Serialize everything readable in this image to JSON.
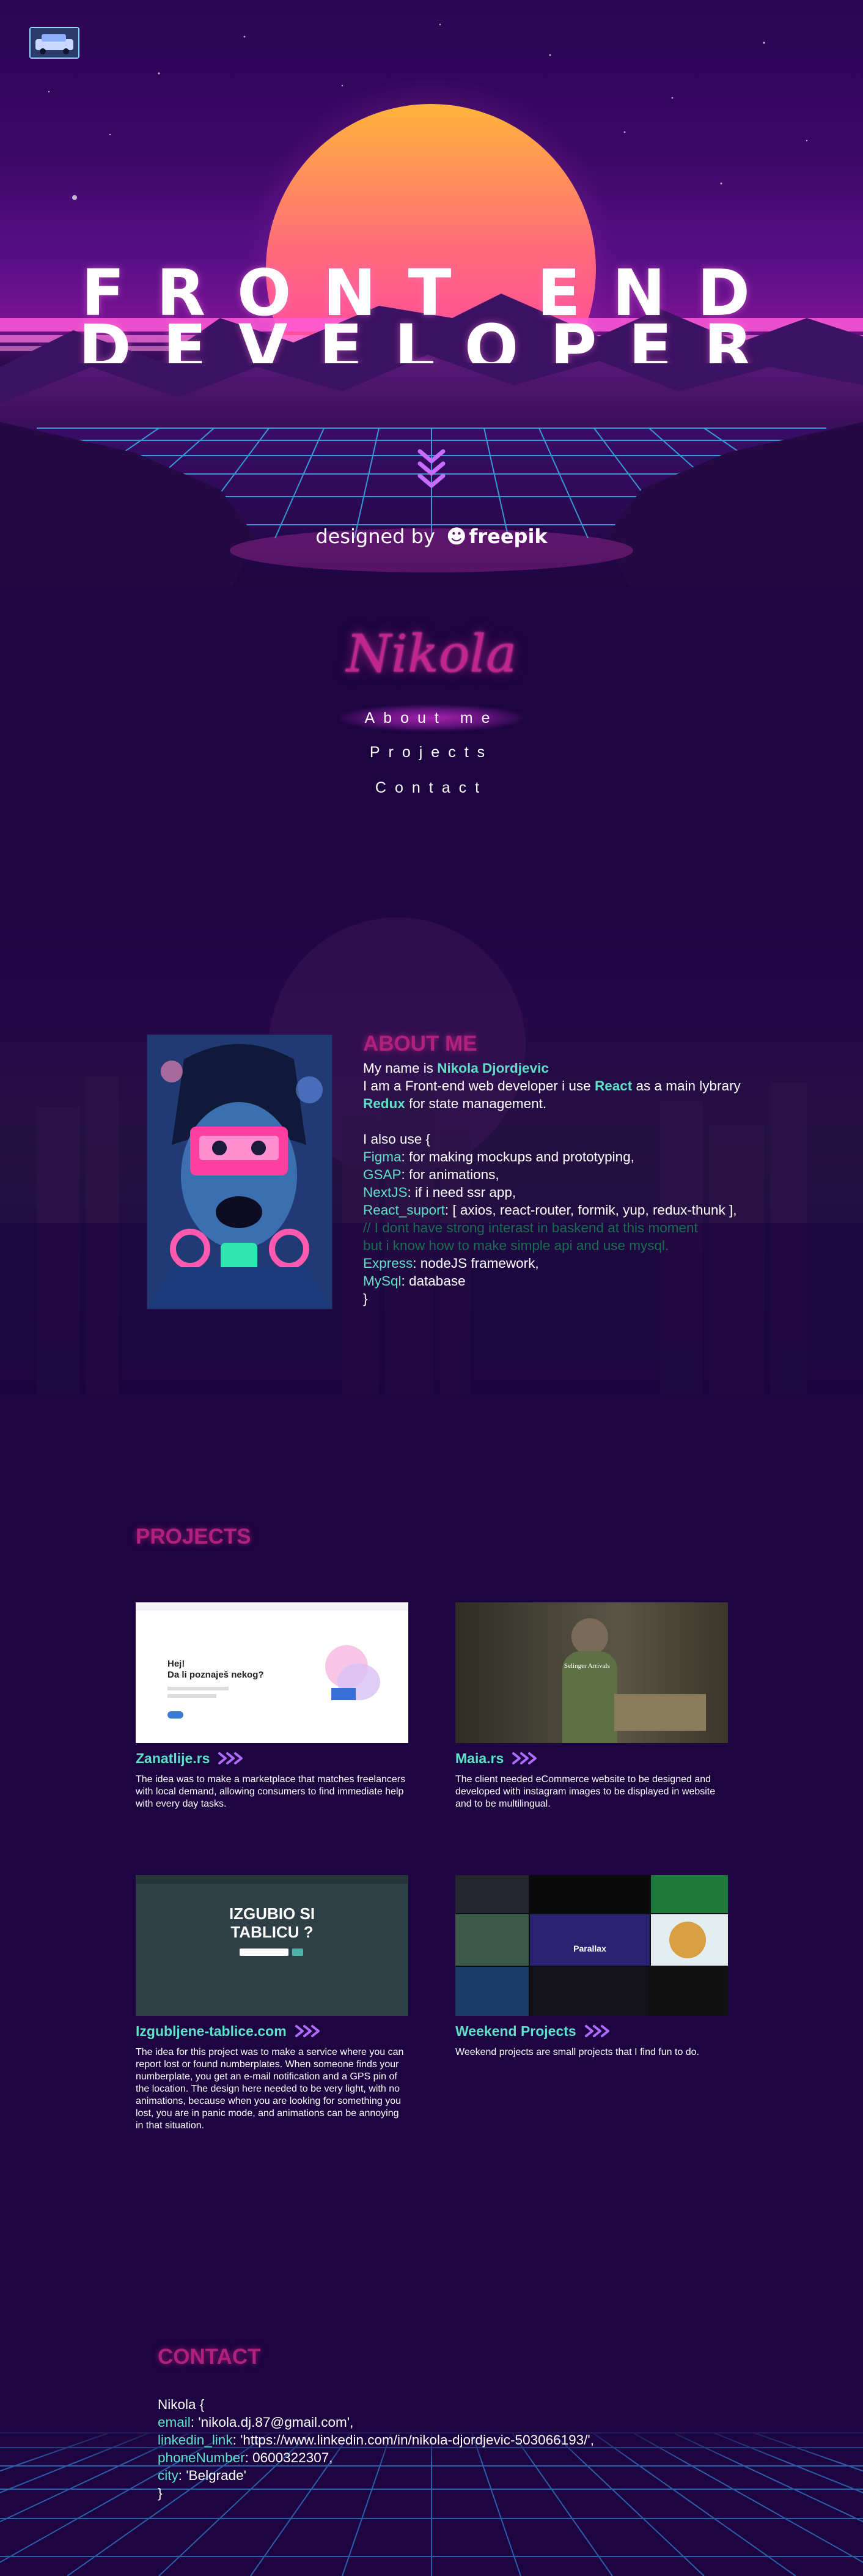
{
  "hero": {
    "title_line1": "FRONT END",
    "title_line2": "DEVELOPER",
    "credit_prefix": "designed by",
    "credit_brand": "freepik"
  },
  "nav": {
    "logo": "Nikola",
    "items": [
      {
        "label": "About me",
        "active": true
      },
      {
        "label": "Projects"
      },
      {
        "label": "Contact"
      }
    ]
  },
  "about": {
    "heading": "ABOUT ME",
    "intro_prefix": "My name is ",
    "name": "Nikola Djordjevic",
    "line2_prefix": "I am a Front-end web developer i use ",
    "react": "React",
    "line2_suffix": " as a main lybrary",
    "redux": "Redux",
    "line3_suffix": " for state management.",
    "also_use": "I also use {",
    "tools": [
      {
        "key": "Figma",
        "value": ": for making mockups and prototyping,"
      },
      {
        "key": "GSAP",
        "value": ": for animations,"
      },
      {
        "key": "NextJS",
        "value": ": if i need ssr app,"
      },
      {
        "key": "React_suport",
        "value": ": [ axios, react-router, formik, yup, redux-thunk ],"
      }
    ],
    "comment_1": "// I dont have strong interast in baskend at this moment",
    "comment_2": "but i know how to make simple api and use mysql.",
    "tools_after": [
      {
        "key": "Express",
        "value": ": nodeJS framework,"
      },
      {
        "key": "MySql",
        "value": ": database"
      }
    ],
    "closing": "}"
  },
  "projects": {
    "heading": "PROJECTS",
    "items": [
      {
        "title": "Zanatlije.rs",
        "description": "The idea was to make a marketplace that matches freelancers with local demand, allowing consumers to find immediate help with every day tasks.",
        "preview_text_1": "Hej!",
        "preview_text_2": "Da li poznaješ nekog?"
      },
      {
        "title": "Maia.rs",
        "description": "The client needed eCommerce website to be designed and developed with instagram images to be displayed in website and to be multilingual.",
        "preview_text_1": "Selinger Arrivals"
      },
      {
        "title": "Izgubljene-tablice.com",
        "description": "The idea for this project was to make a service where you can report lost or found numberplates. When someone finds your numberplate, you get an e-mail notification and a GPS pin of the location. The design here needed to be very light, with no animations, because when you are looking for something you lost, you are in panic mode, and animations can be annoying in that situation.",
        "preview_text_1": "IZGUBIO SI",
        "preview_text_2": "TABLICU ?"
      },
      {
        "title": "Weekend Projects",
        "description": "Weekend projects are small projects that I find fun to do.",
        "preview_text_1": "Parallax"
      }
    ]
  },
  "contact": {
    "heading": "CONTACT",
    "open": "Nikola {",
    "fields": [
      {
        "key": "email",
        "value": ": 'nikola.dj.87@gmail.com',"
      },
      {
        "key": "linkedin_link",
        "value": ": 'https://www.linkedin.com/in/nikola-djordjevic-503066193/',"
      },
      {
        "key": "phoneNumber",
        "value": ": 0600322307,"
      },
      {
        "key": "city",
        "value": ": 'Belgrade'"
      }
    ],
    "close": "}"
  },
  "colors": {
    "accent_teal": "#5fe0c7",
    "heading_magenta": "#b0217c",
    "background": "#1c0540"
  }
}
